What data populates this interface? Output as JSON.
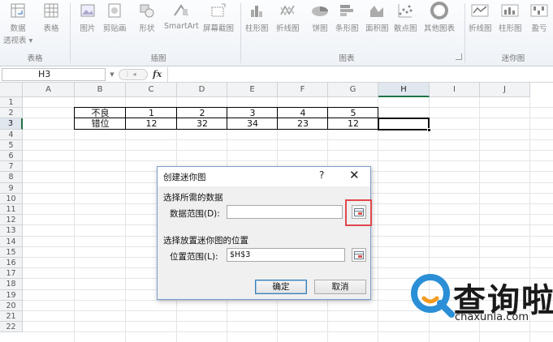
{
  "ribbon": {
    "buttons": [
      {
        "id": "pivot",
        "label": "数据",
        "sub": "透视表 ▾",
        "icon": "pivot-table-icon"
      },
      {
        "id": "table",
        "label": "表格",
        "sub": "",
        "icon": "table-icon"
      },
      {
        "id": "picture",
        "label": "图片",
        "sub": "",
        "icon": "picture-icon"
      },
      {
        "id": "clipart",
        "label": "剪贴画",
        "sub": "",
        "icon": "clipart-icon"
      },
      {
        "id": "shapes",
        "label": "形状",
        "sub": "",
        "icon": "shapes-icon"
      },
      {
        "id": "smartart",
        "label": "SmartArt",
        "sub": "",
        "icon": "smartart-icon"
      },
      {
        "id": "screenshot",
        "label": "屏幕截图",
        "sub": "",
        "icon": "screenshot-icon"
      },
      {
        "id": "column",
        "label": "柱形图",
        "sub": "",
        "icon": "column-chart-icon"
      },
      {
        "id": "line",
        "label": "折线图",
        "sub": "",
        "icon": "line-chart-icon"
      },
      {
        "id": "pie",
        "label": "饼图",
        "sub": "",
        "icon": "pie-chart-icon"
      },
      {
        "id": "bar",
        "label": "条形图",
        "sub": "",
        "icon": "bar-chart-icon"
      },
      {
        "id": "area",
        "label": "面积图",
        "sub": "",
        "icon": "area-chart-icon"
      },
      {
        "id": "scatter",
        "label": "散点图",
        "sub": "",
        "icon": "scatter-chart-icon"
      },
      {
        "id": "other",
        "label": "其他图表",
        "sub": "",
        "icon": "other-chart-icon"
      },
      {
        "id": "sp-line",
        "label": "折线图",
        "sub": "",
        "icon": "sparkline-line-icon"
      },
      {
        "id": "sp-column",
        "label": "柱形图",
        "sub": "",
        "icon": "sparkline-column-icon"
      },
      {
        "id": "sp-winloss",
        "label": "盈亏",
        "sub": "",
        "icon": "sparkline-winloss-icon"
      }
    ],
    "groups": {
      "tables": "表格",
      "illustrations": "插图",
      "charts": "图表",
      "sparklines": "迷你图"
    }
  },
  "formula_bar": {
    "name_box": "H3",
    "fx": "fx"
  },
  "sheet": {
    "columns": [
      "A",
      "B",
      "C",
      "D",
      "E",
      "F",
      "G",
      "H",
      "I",
      "J"
    ],
    "rows": [
      "1",
      "2",
      "3",
      "4",
      "5",
      "6",
      "7",
      "8",
      "9",
      "10",
      "11",
      "12",
      "13",
      "14",
      "15",
      "16",
      "17",
      "18",
      "19",
      "20",
      "21",
      "22"
    ],
    "selected_column": "H",
    "selected_row": "3",
    "table": [
      [
        "不良",
        "1",
        "2",
        "3",
        "4",
        "5"
      ],
      [
        "错位",
        "12",
        "32",
        "34",
        "23",
        "12"
      ]
    ]
  },
  "dialog": {
    "title": "创建迷你图",
    "help": "?",
    "close": "✕",
    "section_data": "选择所需的数据",
    "data_range_label": "数据范围(D):",
    "data_range_value": "",
    "section_location": "选择放置迷你图的位置",
    "location_range_label": "位置范围(L):",
    "location_range_value": "$H$3",
    "ok": "确定",
    "cancel": "取消"
  },
  "watermark": {
    "cn": "查询啦",
    "en": "chaxunla.com"
  },
  "colors": {
    "highlight": "#e0474c",
    "excel_green": "#217346",
    "watermark_blue": "#2a8fd6",
    "watermark_orange": "#f39a1e"
  }
}
